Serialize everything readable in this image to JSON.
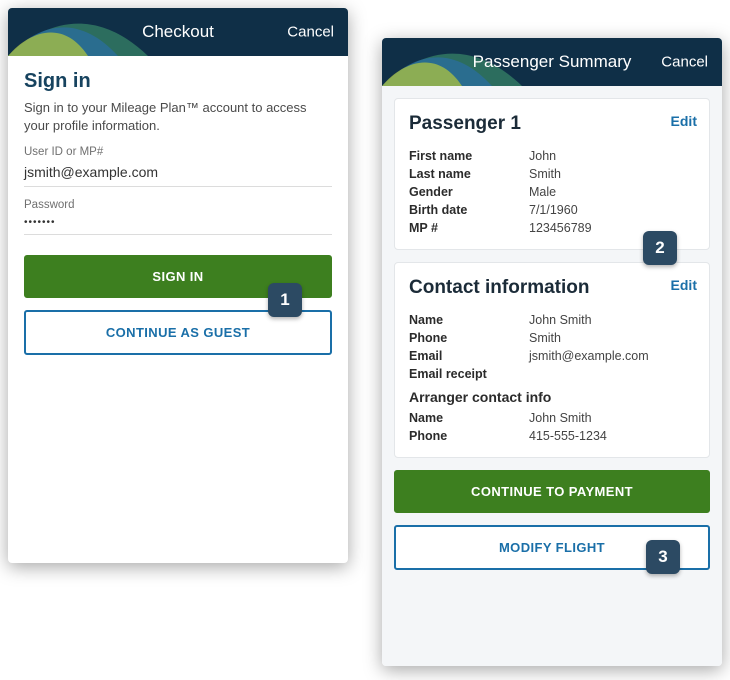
{
  "left": {
    "header": {
      "title": "Checkout",
      "cancel": "Cancel"
    },
    "signin": {
      "title": "Sign in",
      "description": "Sign in to your Mileage Plan™ account to access your profile information.",
      "user_label": "User ID or MP#",
      "user_value": "jsmith@example.com",
      "password_label": "Password",
      "password_value": "•••••••",
      "signin_button": "SIGN IN",
      "guest_button": "CONTINUE AS GUEST"
    }
  },
  "right": {
    "header": {
      "title": "Passenger Summary",
      "cancel": "Cancel"
    },
    "passenger": {
      "heading": "Passenger 1",
      "edit": "Edit",
      "first_name_label": "First name",
      "first_name": "John",
      "last_name_label": "Last name",
      "last_name": "Smith",
      "gender_label": "Gender",
      "gender": "Male",
      "birth_label": "Birth date",
      "birth": "7/1/1960",
      "mp_label": "MP #",
      "mp": "123456789"
    },
    "contact": {
      "heading": "Contact information",
      "edit": "Edit",
      "name_label": "Name",
      "name": "John Smith",
      "phone_label": "Phone",
      "phone": "Smith",
      "email_label": "Email",
      "email": "jsmith@example.com",
      "receipt_label": "Email receipt",
      "arranger_heading": "Arranger contact info",
      "arranger_name_label": "Name",
      "arranger_name": "John Smith",
      "arranger_phone_label": "Phone",
      "arranger_phone": "415-555-1234"
    },
    "buttons": {
      "continue": "CONTINUE TO PAYMENT",
      "modify": "MODIFY FLIGHT"
    }
  },
  "callouts": {
    "one": "1",
    "two": "2",
    "three": "3"
  }
}
